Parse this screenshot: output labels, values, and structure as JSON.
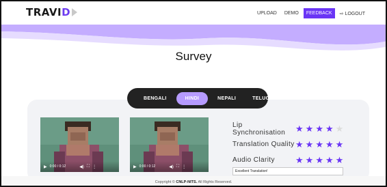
{
  "brand": {
    "part1": "TRAVI",
    "part2": "D"
  },
  "nav": {
    "items": [
      {
        "label": "UPLOAD"
      },
      {
        "label": "DEMO"
      },
      {
        "label": "FEEDBACK"
      },
      {
        "label": "LOGOUT"
      }
    ],
    "active": "FEEDBACK"
  },
  "page": {
    "title": "Survey"
  },
  "languages": [
    "BENGALI",
    "HINDI",
    "NEPALI",
    "TELUGU"
  ],
  "active_language": "HINDI",
  "videos": [
    {
      "time": "0:00 / 0:12"
    },
    {
      "time": "0:00 / 0:12"
    }
  ],
  "ratings": [
    {
      "label": "Lip Synchronisation",
      "stars": 4,
      "max": 5
    },
    {
      "label": "Translation Quality",
      "stars": 5,
      "max": 5
    },
    {
      "label": "Audio Clarity",
      "stars": 5,
      "max": 5
    }
  ],
  "feedback": {
    "value": "Excellent Translation!"
  },
  "footer": {
    "prefix": "Copyright ©",
    "owner": "CNLP-NITS.",
    "suffix": "All Rights Reserved."
  },
  "colors": {
    "accent": "#6a35f5",
    "wave": "#c4adff",
    "tab_active": "#b69bff"
  }
}
